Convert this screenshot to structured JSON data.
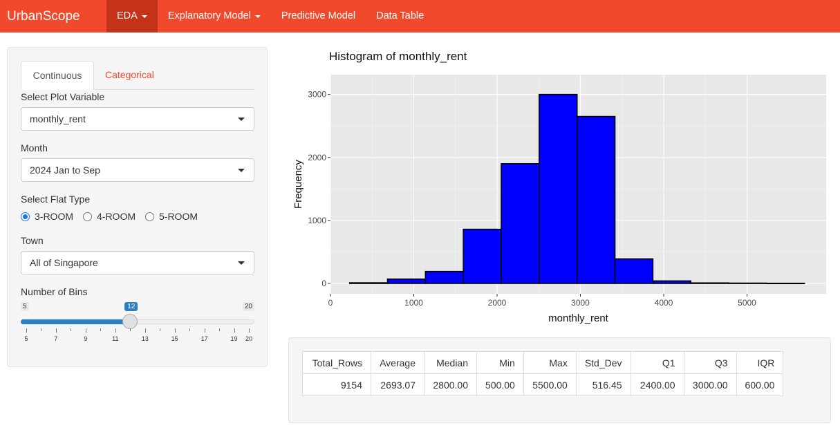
{
  "navbar": {
    "brand": "UrbanScope",
    "items": [
      {
        "label": "EDA",
        "dropdown": true,
        "active": true
      },
      {
        "label": "Explanatory Model",
        "dropdown": true,
        "active": false
      },
      {
        "label": "Predictive Model",
        "dropdown": false,
        "active": false
      },
      {
        "label": "Data Table",
        "dropdown": false,
        "active": false
      }
    ],
    "color": "#f0492b",
    "active_color": "#c5321a"
  },
  "sidebar": {
    "tabs": [
      {
        "label": "Continuous",
        "active": true
      },
      {
        "label": "Categorical",
        "active": false
      }
    ],
    "plot_variable": {
      "label": "Select Plot Variable",
      "value": "monthly_rent"
    },
    "month": {
      "label": "Month",
      "value": "2024 Jan to Sep"
    },
    "flat_type": {
      "label": "Select Flat Type",
      "options": [
        "3-ROOM",
        "4-ROOM",
        "5-ROOM"
      ],
      "selected": "3-ROOM"
    },
    "town": {
      "label": "Town",
      "value": "All of Singapore"
    },
    "bins": {
      "label": "Number of Bins",
      "min": 5,
      "max": 20,
      "value": 12,
      "min_label": "5",
      "max_label": "20",
      "value_label": "12",
      "tick_labels": [
        "5",
        "7",
        "9",
        "11",
        "13",
        "15",
        "17",
        "19",
        "20"
      ]
    }
  },
  "chart_data": {
    "type": "bar",
    "title": "Histogram of monthly_rent",
    "xlabel": "monthly_rent",
    "ylabel": "Frequency",
    "bin_edges": [
      230,
      685,
      1140,
      1595,
      2050,
      2505,
      2960,
      3415,
      3870,
      4325,
      4780,
      5235,
      5690
    ],
    "values": [
      10,
      70,
      190,
      860,
      1900,
      3000,
      2650,
      390,
      40,
      8,
      5,
      3
    ],
    "xlim": [
      0,
      5950
    ],
    "ylim": [
      0,
      3150
    ],
    "x_ticks": [
      "0",
      "1000",
      "2000",
      "3000",
      "4000",
      "5000"
    ],
    "y_ticks": [
      "0",
      "1000",
      "2000",
      "3000"
    ],
    "bar_fill": "#0000ff",
    "bar_stroke": "#000000",
    "panel_bg": "#e8e8e8",
    "grid": true
  },
  "stats": {
    "headers": [
      "Total_Rows",
      "Average",
      "Median",
      "Min",
      "Max",
      "Std_Dev",
      "Q1",
      "Q3",
      "IQR"
    ],
    "values": [
      "9154",
      "2693.07",
      "2800.00",
      "500.00",
      "5500.00",
      "516.45",
      "2400.00",
      "3000.00",
      "600.00"
    ]
  }
}
